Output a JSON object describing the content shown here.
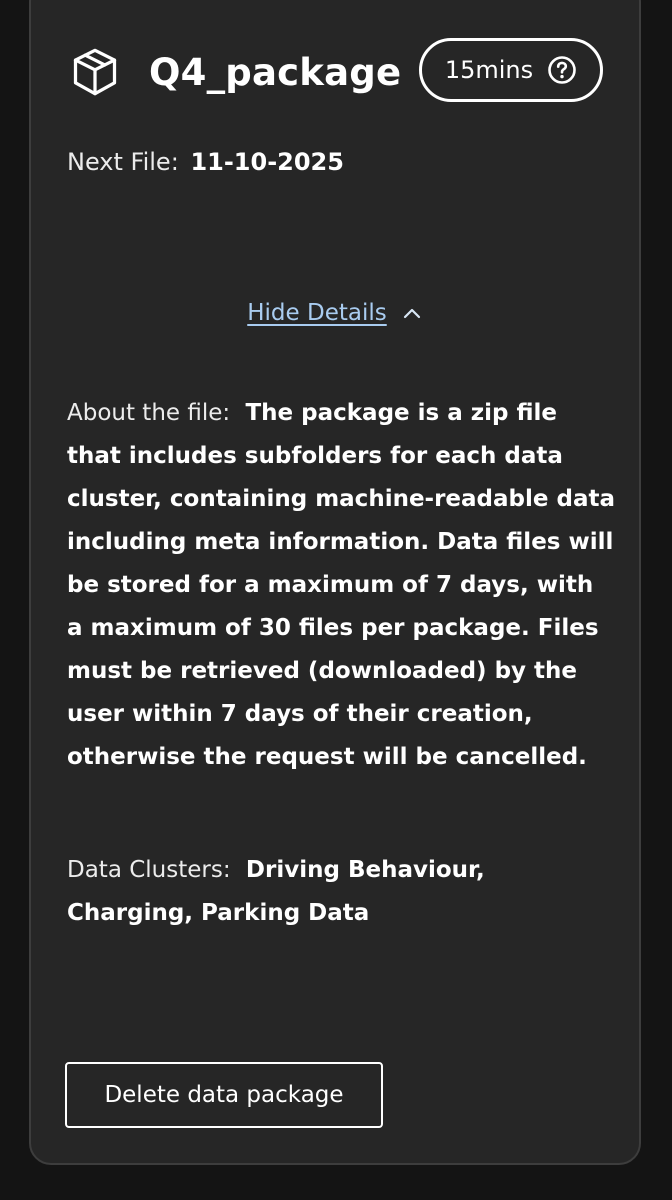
{
  "card": {
    "title": "Q4_package",
    "title_icon": "package-box-icon",
    "duration_badge": {
      "label": "15mins",
      "icon": "question-circle-icon"
    },
    "next_file": {
      "label": "Next File:",
      "value": "11-10-2025"
    },
    "details_toggle": {
      "label": "Hide Details",
      "icon": "chevron-up-icon"
    },
    "about": {
      "label": "About the file:",
      "value": "The package is a zip file that includes subfolders for each data cluster, containing machine-readable data including meta information. Data files will be stored for a maximum of 7 days, with a maximum of 30 files per package. Files must be retrieved (downloaded) by the user within 7 days of their creation, otherwise the request will be cancelled."
    },
    "data_clusters": {
      "label": "Data Clusters:",
      "value": "Driving Behaviour, Charging, Parking Data"
    },
    "delete_button": {
      "label": "Delete data package"
    }
  },
  "colors": {
    "page_background": "#141414",
    "card_background": "#262626",
    "card_border": "#3d3d3d",
    "link": "#a9ccf0",
    "text": "#ffffff"
  }
}
